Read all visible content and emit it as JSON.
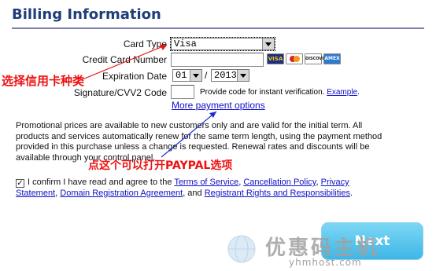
{
  "header": {
    "title": "Billing Information"
  },
  "form": {
    "card_type_label": "Card Type",
    "card_type_value": "Visa",
    "card_number_label": "Credit Card Number",
    "expiration_label": "Expiration Date",
    "exp_month_value": "01",
    "exp_separator": "/",
    "exp_year_value": "2013",
    "cvv_label": "Signature/CVV2 Code",
    "cvv_hint": "Provide code for instant verification.",
    "cvv_example_link": "Example",
    "more_payment_link": "More payment options"
  },
  "card_logos": [
    "VISA",
    "MC",
    "DISCOVER",
    "AMEX"
  ],
  "promo_text": "Promotional prices are available to new customers only and are valid for the initial term. All products and services automatically renew for the same term length, using the payment method provided in this purchase unless a change is requested. Renewal rates and discounts will be available through your control panel.",
  "agreement": {
    "checked": true,
    "prefix": "I confirm I have read and agree to the",
    "terms_link": "Terms of Service",
    "cancel_link": "Cancellation Policy",
    "privacy_link": "Privacy Statement",
    "domain_link": "Domain Registration Agreement",
    "and_text": ", and",
    "registrant_link": "Registrant Rights and Responsibilities"
  },
  "buttons": {
    "next_label": "Next"
  },
  "annotations": {
    "select_card_type": "选择信用卡种类",
    "click_paypal": "点这个可以打开PAYPAL选项"
  },
  "watermark": {
    "site_name": "优惠码主机",
    "site_url": "yhmhost.com"
  }
}
